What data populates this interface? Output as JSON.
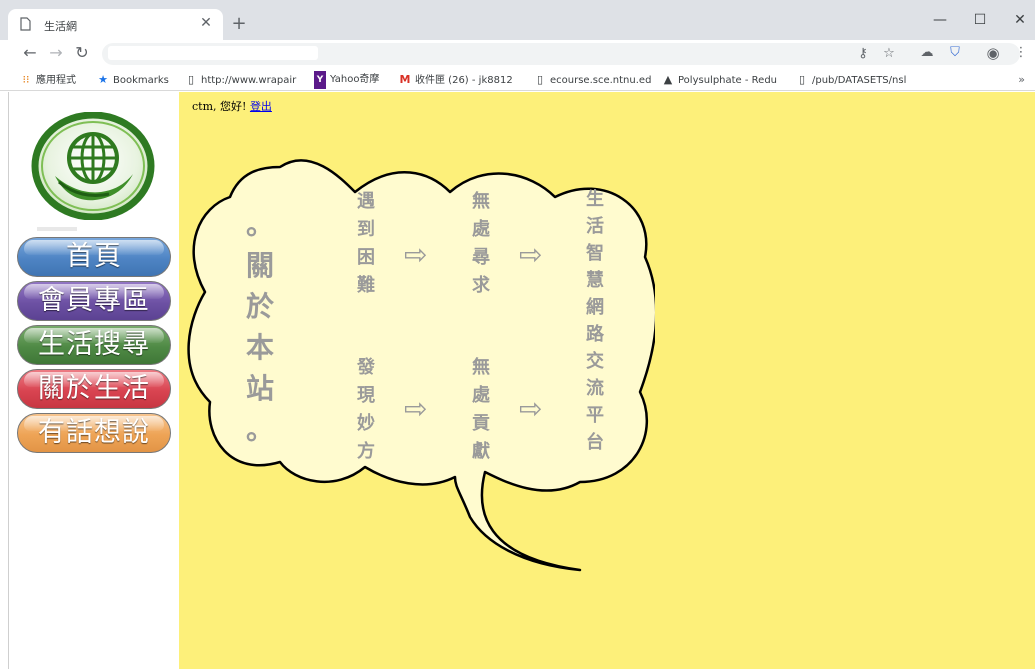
{
  "browser": {
    "tab_title": "生活網",
    "url": "",
    "bookmarks": [
      {
        "icon": "apps-icon",
        "label": "應用程式"
      },
      {
        "icon": "star-icon",
        "label": "Bookmarks"
      },
      {
        "icon": "page-icon",
        "label": "http://www.wrapair"
      },
      {
        "icon": "yahoo-icon",
        "label": "Yahoo奇摩"
      },
      {
        "icon": "gmail-icon",
        "label": "收件匣 (26) - jk8812"
      },
      {
        "icon": "page-icon",
        "label": "ecourse.sce.ntnu.ed"
      },
      {
        "icon": "drive-icon",
        "label": "Polysulphate - Redu"
      },
      {
        "icon": "page-icon",
        "label": "/pub/DATASETS/nsl"
      }
    ]
  },
  "sidebar": {
    "menu": [
      {
        "label": "首頁",
        "color": "#4e84c4"
      },
      {
        "label": "會員專區",
        "color": "#6d51a4"
      },
      {
        "label": "生活搜尋",
        "color": "#4f8a45"
      },
      {
        "label": "關於生活",
        "color": "#d94451"
      },
      {
        "label": "有話想說",
        "color": "#eea456"
      }
    ]
  },
  "main": {
    "greeting": "ctm, 您好!",
    "logout": "登出",
    "bubble": {
      "title": [
        "。",
        "關",
        "於",
        "本",
        "站",
        "。"
      ],
      "col2_top": [
        "遇",
        "到",
        "困",
        "難"
      ],
      "col2_bottom": [
        "發",
        "現",
        "妙",
        "方"
      ],
      "col3_top": [
        "無",
        "處",
        "尋",
        "求"
      ],
      "col3_bottom": [
        "無",
        "處",
        "貢",
        "獻"
      ],
      "col4": [
        "生",
        "活",
        "智",
        "慧",
        "網",
        "路",
        "交",
        "流",
        "平",
        "台"
      ]
    }
  },
  "colors": {
    "page_bg": "#fdf07a",
    "bubble_fill": "#fffbcf",
    "bubble_text": "#9a9a9a"
  }
}
